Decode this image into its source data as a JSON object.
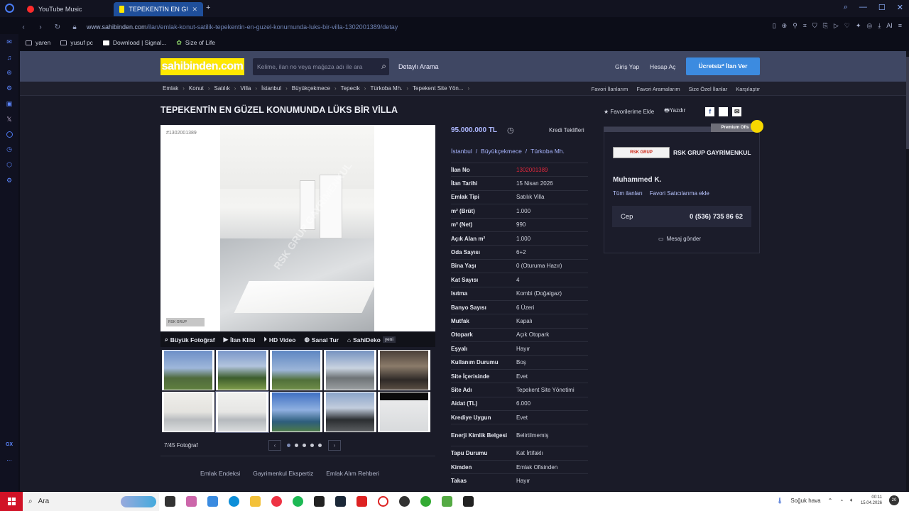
{
  "browser": {
    "tabs": [
      {
        "label": "YouTube Music",
        "active": false
      },
      {
        "label": "TEPEKENTİN EN GÜZEL K",
        "active": true
      }
    ],
    "new_tab": "+",
    "url_host": "www.sahibinden.com",
    "url_path": "/ilan/emlak-konut-satilik-tepekentin-en-guzel-konumunda-luks-bir-villa-1302001389/detay",
    "ai_label": "AI",
    "bookmarks": [
      {
        "label": "yaren"
      },
      {
        "label": "yusuf pc"
      },
      {
        "label": "Download | Signal..."
      },
      {
        "label": "Size of Life"
      }
    ],
    "rail_label": "GX",
    "rail_more": "..."
  },
  "site": {
    "logo_text": "sahibinden.com",
    "search_placeholder": "Kelime, ilan no veya mağaza adı ile ara",
    "detailed_search": "Detaylı Arama",
    "login": "Giriş Yap",
    "register": "Hesap Aç",
    "post_ad": "Ücretsiz* İlan Ver",
    "breadcrumbs": [
      "Emlak",
      "Konut",
      "Satılık",
      "Villa",
      "İstanbul",
      "Büyükçekmece",
      "Tepecik",
      "Türkoba Mh.",
      "Tepekent Site Yön..."
    ],
    "breadcrumb_sep": "›",
    "right_links": [
      "Favori İlanlarım",
      "Favori Aramalarım",
      "Size Özel İlanlar",
      "Karşılaştır"
    ]
  },
  "listing": {
    "title": "TEPEKENTİN EN GÜZEL KONUMUNDA LÜKS BİR VİLLA",
    "add_favorite": "Favorilerime Ekle",
    "print": "Yazdır",
    "share_icons": [
      "f",
      "",
      "✉"
    ],
    "photo_id": "#1302001389",
    "photo_watermark": "RSK GRUP GAYRİMENKUL",
    "photo_logo": "RSK GRUP",
    "photo_tools": [
      "Büyük Fotoğraf",
      "İlan Klibi",
      "HD Video",
      "Sanal Tur",
      "SahiDeko"
    ],
    "new_badge": "yeni",
    "photo_counter": "7/45 Fotoğraf",
    "pager_prev": "‹",
    "pager_next": "›",
    "price": "95.000.000 TL",
    "credit_offers": "Kredi Teklifleri",
    "location": [
      "İstanbul",
      "Büyükçekmece",
      "Türkoba Mh."
    ],
    "location_sep": "/",
    "details": [
      {
        "k": "İlan No",
        "v": "1302001389"
      },
      {
        "k": "İlan Tarihi",
        "v": "15 Nisan 2026"
      },
      {
        "k": "Emlak Tipi",
        "v": "Satılık Villa"
      },
      {
        "k": "m² (Brüt)",
        "v": "1.000"
      },
      {
        "k": "m² (Net)",
        "v": "990"
      },
      {
        "k": "Açık Alan m²",
        "v": "1.000"
      },
      {
        "k": "Oda Sayısı",
        "v": "6+2"
      },
      {
        "k": "Bina Yaşı",
        "v": "0 (Oturuma Hazır)"
      },
      {
        "k": "Kat Sayısı",
        "v": "4"
      },
      {
        "k": "Isıtma",
        "v": "Kombi (Doğalgaz)"
      },
      {
        "k": "Banyo Sayısı",
        "v": "6 Üzeri"
      },
      {
        "k": "Mutfak",
        "v": "Kapalı"
      },
      {
        "k": "Otopark",
        "v": "Açık Otopark"
      },
      {
        "k": "Eşyalı",
        "v": "Hayır"
      },
      {
        "k": "Kullanım Durumu",
        "v": "Boş"
      },
      {
        "k": "Site İçerisinde",
        "v": "Evet"
      },
      {
        "k": "Site Adı",
        "v": "Tepekent Site Yönetimi"
      },
      {
        "k": "Aidat (TL)",
        "v": "6.000"
      },
      {
        "k": "Krediye Uygun",
        "v": "Evet"
      },
      {
        "k": "Enerji Kimlik Belgesi",
        "v": "Belirtilmemiş"
      },
      {
        "k": "Tapu Durumu",
        "v": "Kat İrtifaklı"
      },
      {
        "k": "Kimden",
        "v": "Emlak Ofisinden"
      },
      {
        "k": "Takas",
        "v": "Hayır"
      }
    ],
    "footer_links": [
      "Emlak Endeksi",
      "Gayrimenkul Ekspertiz",
      "Emlak Alım Rehberi"
    ]
  },
  "seller": {
    "premium_label": "Premium Ofis",
    "firm_logo": "RSK GRUP",
    "firm_name": "RSK GRUP GAYRİMENKUL",
    "person": "Muhammed K.",
    "all_ads": "Tüm ilanları",
    "add_fav_seller": "Favori Satıcılarıma ekle",
    "phone_label": "Cep",
    "phone": "0 (536) 735 86 62",
    "message": "Mesaj gönder"
  },
  "taskbar": {
    "search": "Ara",
    "weather": "Soğuk hava",
    "time": "00:11",
    "date": "15.04.2026",
    "notifications": "20"
  },
  "colors": {
    "accent": "#3c8be0",
    "logo_bg": "#ffe800",
    "link": "#a8b5ff",
    "listing_no": "#e0283c",
    "start": "#d11226"
  }
}
